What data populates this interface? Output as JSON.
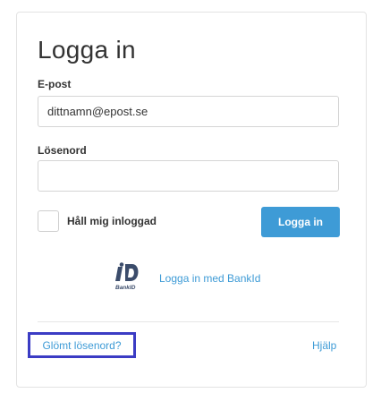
{
  "login": {
    "title": "Logga in",
    "email_label": "E-post",
    "email_value": "dittnamn@epost.se",
    "password_label": "Lösenord",
    "password_value": "",
    "remember_label": "Håll mig inloggad",
    "remember_checked": false,
    "submit_label": "Logga in",
    "bankid_logo_text": "BankID",
    "bankid_label": "Logga in med BankId",
    "forgot_label": "Glömt lösenord?",
    "help_label": "Hjälp"
  },
  "colors": {
    "accent": "#3e9bd6",
    "highlight_border": "#3b3cc4",
    "text": "#333333"
  },
  "icons": {
    "bankid": "bankid-logo-icon"
  }
}
